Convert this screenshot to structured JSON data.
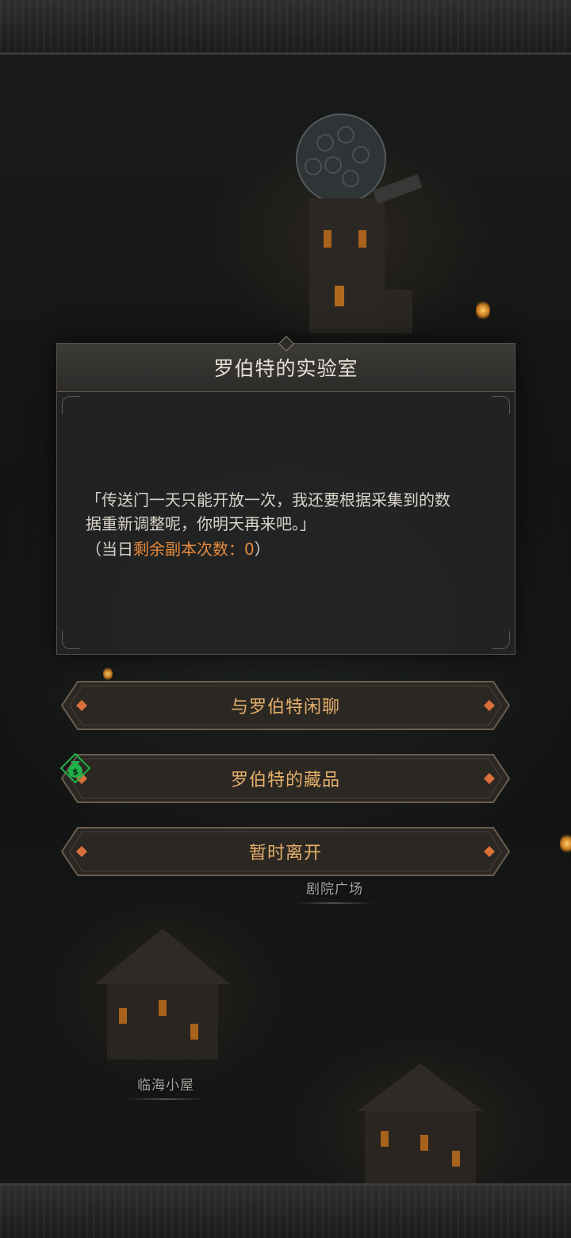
{
  "dialog": {
    "title": "罗伯特的实验室",
    "line1": "「传送门一天只能开放一次，我还要根据采集到的数",
    "line2": "据重新调整呢，你明天再来吧。」",
    "count_prefix": "（当日",
    "count_label": "剩余副本次数：0",
    "count_suffix": "）"
  },
  "options": [
    {
      "label": "与罗伯特闲聊"
    },
    {
      "label": "罗伯特的藏品",
      "icon": "money-bag-icon"
    },
    {
      "label": "暂时离开"
    }
  ],
  "map_labels": {
    "theater_square": "剧院广场",
    "seaside_hut": "临海小屋"
  },
  "colors": {
    "accent_orange": "#e48a3c",
    "option_text": "#e6b16a",
    "money_icon": "#1fb14a"
  }
}
